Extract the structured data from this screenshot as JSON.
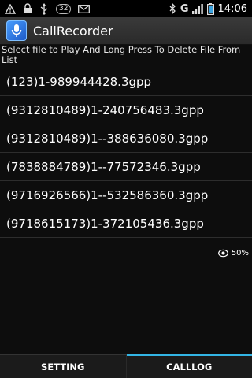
{
  "status_bar": {
    "notification_badge": "32",
    "network_label": "G",
    "time": "14:06",
    "icons": [
      "warning-icon",
      "lock-icon",
      "usb-icon",
      "mail-icon",
      "bluetooth-icon",
      "signal-icon",
      "battery-icon"
    ]
  },
  "app": {
    "title": "CallRecorder"
  },
  "instruction": "Select file to Play And Long Press To Delete File From List",
  "files": [
    "(123)1-989944428.3gpp",
    "(9312810489)1-240756483.3gpp",
    "(9312810489)1--388636080.3gpp",
    "(7838884789)1--77572346.3gpp",
    "(9716926566)1--532586360.3gpp",
    "(9718615173)1-372105436.3gpp"
  ],
  "zoom": {
    "label": "50%"
  },
  "tabs": [
    {
      "label": "SETTING",
      "active": false
    },
    {
      "label": "CALLLOG",
      "active": true
    }
  ],
  "colors": {
    "accent": "#33b5e5",
    "background": "#0d0d0d"
  }
}
